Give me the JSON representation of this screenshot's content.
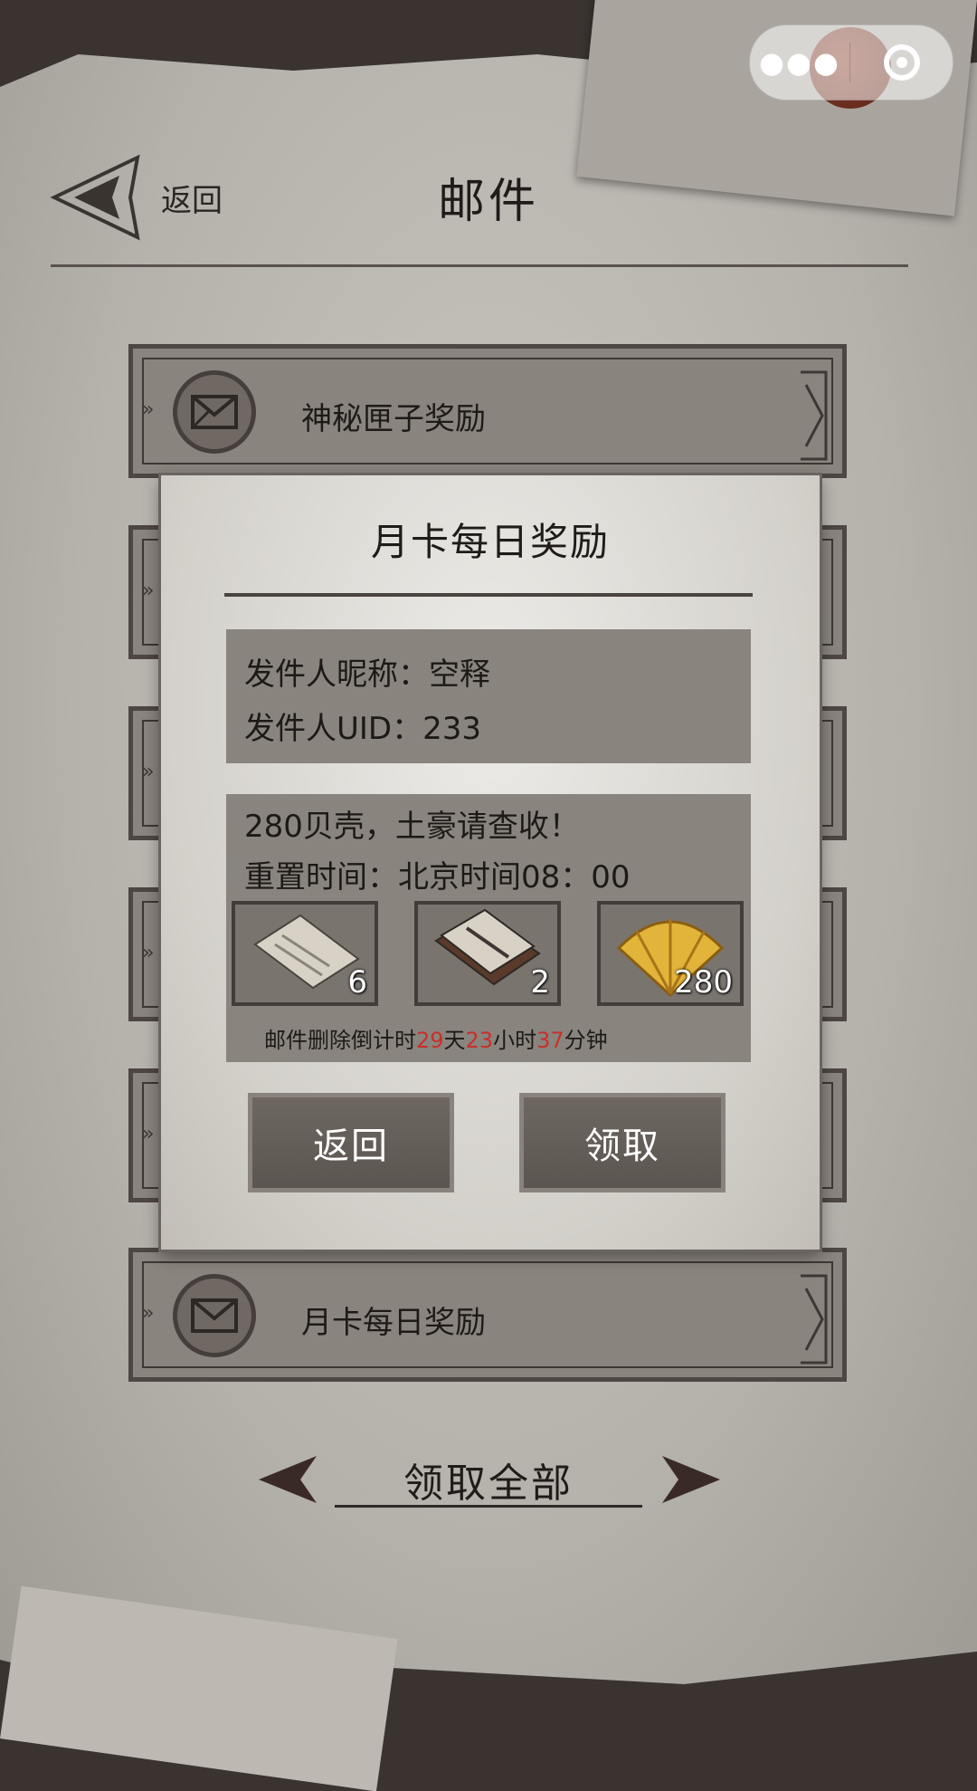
{
  "header": {
    "back_label": "返回",
    "title": "邮件"
  },
  "mail_list": [
    {
      "label": "神秘匣子奖励"
    },
    {
      "label": "月卡每日奖励"
    }
  ],
  "modal": {
    "title": "月卡每日奖励",
    "sender_nickname": "发件人昵称：空释",
    "sender_uid": "发件人UID：233",
    "message": "280贝壳，土豪请查收！",
    "reset_time": "重置时间：北京时间08：00",
    "items": [
      {
        "icon": "paper-scroll-icon",
        "count": "6"
      },
      {
        "icon": "letter-bundle-icon",
        "count": "2"
      },
      {
        "icon": "shell-icon",
        "count": "280"
      }
    ],
    "countdown": {
      "prefix": "邮件删除倒计时",
      "days": "29",
      "days_unit": "天",
      "hours": "23",
      "hours_unit": "小时",
      "minutes": "37",
      "minutes_unit": "分钟"
    },
    "back_button": "返回",
    "claim_button": "领取"
  },
  "footer": {
    "claim_all": "领取全部"
  },
  "colors": {
    "countdown_highlight": "#c8302a",
    "panel": "#8a847e",
    "button": "#5b5550"
  }
}
